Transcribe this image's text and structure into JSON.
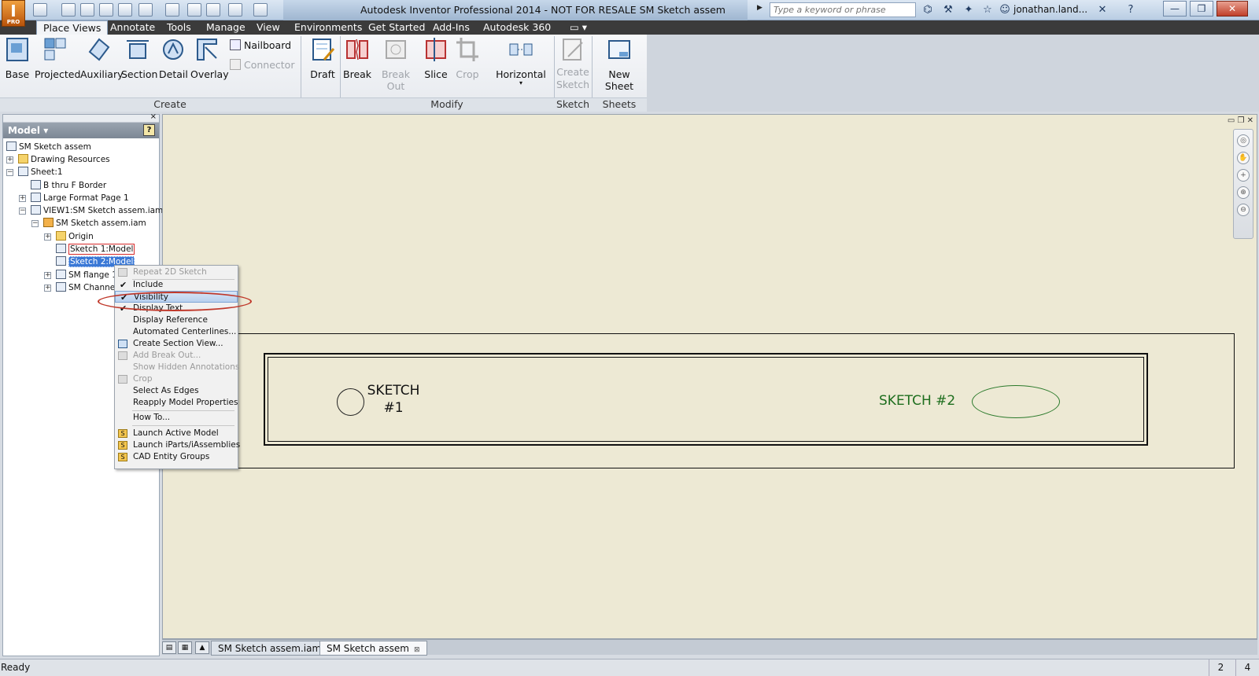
{
  "window": {
    "title": "Autodesk Inventor Professional 2014 - NOT FOR RESALE   SM Sketch assem",
    "logo_letter": "I",
    "logo_sub": "PRO",
    "search_placeholder": "Type a keyword or phrase",
    "user": "jonathan.land...",
    "minimize": "—",
    "restore": "❐",
    "close": "✕"
  },
  "tabs": [
    "Place Views",
    "Annotate",
    "Tools",
    "Manage",
    "View",
    "Environments",
    "Get Started",
    "Add-Ins",
    "Autodesk 360"
  ],
  "ribbon": {
    "create": {
      "label": "Create",
      "base": "Base",
      "projected": "Projected",
      "auxiliary": "Auxiliary",
      "section": "Section",
      "detail": "Detail",
      "overlay": "Overlay",
      "nailboard": "Nailboard",
      "connector": "Connector",
      "draft": "Draft"
    },
    "modify": {
      "label": "Modify",
      "break": "Break",
      "break_out": "Break Out",
      "slice": "Slice",
      "crop": "Crop",
      "horizontal": "Horizontal"
    },
    "sketch": {
      "label": "Sketch",
      "create_sketch_1": "Create",
      "create_sketch_2": "Sketch"
    },
    "sheets": {
      "label": "Sheets",
      "new_sheet": "New Sheet"
    }
  },
  "browser": {
    "header": "Model ▾",
    "help": "?",
    "tree": [
      "SM Sketch assem",
      "Drawing Resources",
      "Sheet:1",
      "B thru F Border",
      "Large Format Page 1",
      "VIEW1:SM Sketch assem.iam",
      "SM Sketch assem.iam",
      "Origin",
      "Sketch 1:Model",
      "Sketch 2:Model",
      "SM flange 1",
      "SM Channel"
    ]
  },
  "context_menu": [
    "Repeat 2D Sketch",
    "Include",
    "Visibility",
    "Display Text",
    "Display Reference",
    "Automated Centerlines...",
    "Create Section View...",
    "Add Break Out...",
    "Show Hidden Annotations",
    "Crop",
    "Select As Edges",
    "Reapply Model Properties",
    "How To...",
    "Launch Active Model",
    "Launch iParts/iAssemblies",
    "CAD Entity Groups"
  ],
  "drawing": {
    "sketch1_line1": "SKETCH",
    "sketch1_line2": "#1",
    "sketch2": "SKETCH #2",
    "sketch2_color": "#1e6e1e"
  },
  "doc_tabs": [
    "SM Sketch assem.iam",
    "SM Sketch assem"
  ],
  "status": {
    "text": "Ready",
    "n1": "2",
    "n2": "4"
  },
  "colors": {
    "highlight_callout": "#c0392b",
    "selection": "#3a78d6",
    "canvas_bg": "#ede9d4"
  }
}
